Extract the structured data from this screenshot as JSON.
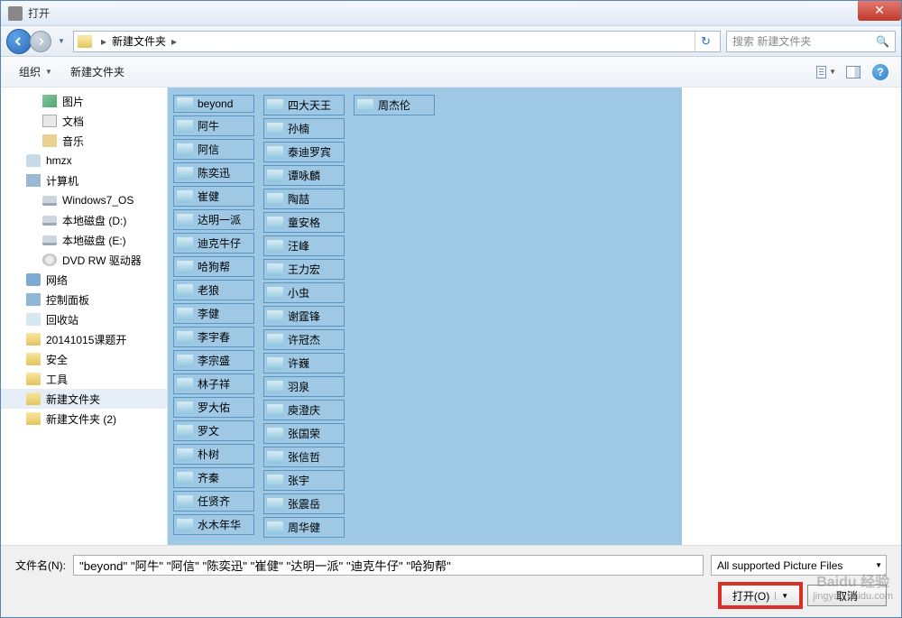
{
  "window": {
    "title": "打开"
  },
  "address": {
    "path": "新建文件夹"
  },
  "search": {
    "placeholder": "搜索 新建文件夹"
  },
  "toolbar": {
    "organize": "组织",
    "newfolder": "新建文件夹"
  },
  "sidebar": {
    "items": [
      {
        "label": "图片",
        "lvl": 2,
        "icon": "ico-pic"
      },
      {
        "label": "文档",
        "lvl": 2,
        "icon": "ico-doc"
      },
      {
        "label": "音乐",
        "lvl": 2,
        "icon": "ico-music"
      },
      {
        "label": "hmzx",
        "lvl": 1,
        "icon": "ico-user"
      },
      {
        "label": "计算机",
        "lvl": 1,
        "icon": "ico-comp"
      },
      {
        "label": "Windows7_OS",
        "lvl": 2,
        "icon": "ico-drive"
      },
      {
        "label": "本地磁盘 (D:)",
        "lvl": 2,
        "icon": "ico-drive"
      },
      {
        "label": "本地磁盘 (E:)",
        "lvl": 2,
        "icon": "ico-drive"
      },
      {
        "label": "DVD RW 驱动器",
        "lvl": 2,
        "icon": "ico-dvd"
      },
      {
        "label": "网络",
        "lvl": 1,
        "icon": "ico-net"
      },
      {
        "label": "控制面板",
        "lvl": 1,
        "icon": "ico-cp"
      },
      {
        "label": "回收站",
        "lvl": 1,
        "icon": "ico-recycle"
      },
      {
        "label": "20141015课题开",
        "lvl": 1,
        "icon": "ico-folder"
      },
      {
        "label": "安全",
        "lvl": 1,
        "icon": "ico-folder"
      },
      {
        "label": "工具",
        "lvl": 1,
        "icon": "ico-folder"
      },
      {
        "label": "新建文件夹",
        "lvl": 1,
        "icon": "ico-folder",
        "sel": true
      },
      {
        "label": "新建文件夹 (2)",
        "lvl": 1,
        "icon": "ico-folder"
      }
    ]
  },
  "files": {
    "col1": [
      "beyond",
      "阿牛",
      "阿信",
      "陈奕迅",
      "崔健",
      "达明一派",
      "迪克牛仔",
      "哈狗帮",
      "老狼",
      "李健",
      "李宇春",
      "李宗盛",
      "林子祥",
      "罗大佑",
      "罗文",
      "朴树",
      "齐秦",
      "任贤齐",
      "水木年华"
    ],
    "col2": [
      "四大天王",
      "孙楠",
      "泰迪罗宾",
      "谭咏麟",
      "陶喆",
      "童安格",
      "汪峰",
      "王力宏",
      "小虫",
      "谢霆锋",
      "许冠杰",
      "许巍",
      "羽泉",
      "庾澄庆",
      "张国荣",
      "张信哲",
      "张宇",
      "张震岳",
      "周华健"
    ],
    "col3": [
      "周杰伦"
    ]
  },
  "bottom": {
    "filename_label": "文件名(N):",
    "filename_value": "\"beyond\" \"阿牛\" \"阿信\" \"陈奕迅\" \"崔健\" \"达明一派\" \"迪克牛仔\" \"哈狗帮\"",
    "filter": "All supported Picture Files",
    "open": "打开(O)",
    "cancel": "取消"
  },
  "watermark": {
    "brand": "Baidu 经验",
    "url": "jingyan.baidu.com"
  }
}
